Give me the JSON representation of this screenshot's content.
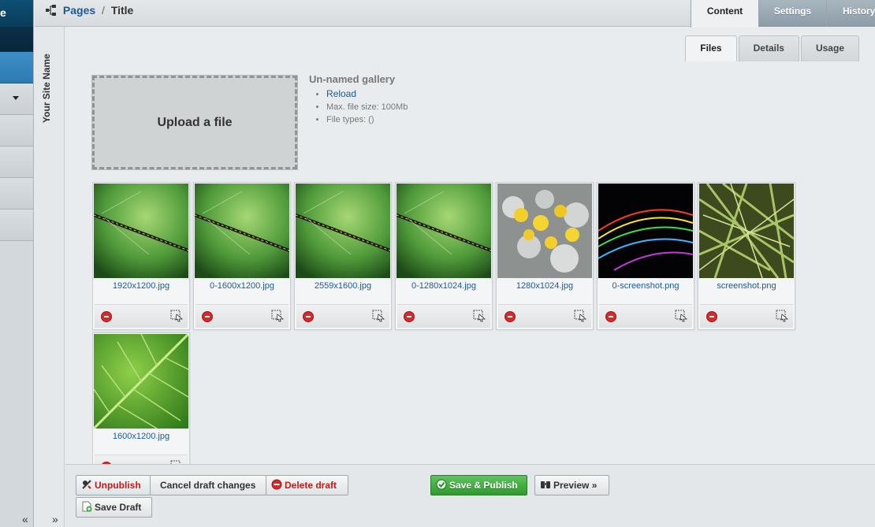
{
  "header": {
    "breadcrumb_parent": "Pages",
    "breadcrumb_separator": "/",
    "breadcrumb_current": "Title",
    "tabs": [
      {
        "label": "Content",
        "active": true
      },
      {
        "label": "Settings",
        "active": false
      },
      {
        "label": "History",
        "active": false
      }
    ]
  },
  "leftnav": {
    "brand_fragment": "e",
    "expand_label": "«"
  },
  "sitecol": {
    "site_name": "Your Site Name",
    "collapse_label": "»"
  },
  "subtabs": [
    {
      "label": "Files",
      "active": true
    },
    {
      "label": "Details",
      "active": false
    },
    {
      "label": "Usage",
      "active": false
    }
  ],
  "upload": {
    "label": "Upload a file"
  },
  "gallery": {
    "title": "Un-named gallery",
    "reload": "Reload",
    "max_size": "Max. file size: 100Mb",
    "file_types": "File types: ()"
  },
  "files": [
    {
      "name": "1920x1200.jpg",
      "thumb": "dragonfly"
    },
    {
      "name": "0-1600x1200.jpg",
      "thumb": "dragonfly"
    },
    {
      "name": "2559x1600.jpg",
      "thumb": "dragonfly"
    },
    {
      "name": "0-1280x1024.jpg",
      "thumb": "dragonfly"
    },
    {
      "name": "1280x1024.jpg",
      "thumb": "flowers"
    },
    {
      "name": "0-screenshot.png",
      "thumb": "lights"
    },
    {
      "name": "screenshot.png",
      "thumb": "grass"
    },
    {
      "name": "1600x1200.jpg",
      "thumb": "leaf"
    }
  ],
  "actions": {
    "unpublish": "Unpublish",
    "cancel_draft": "Cancel draft changes",
    "delete_draft": "Delete draft",
    "save_publish": "Save & Publish",
    "preview": "Preview »",
    "save_draft": "Save Draft"
  },
  "colors": {
    "accent": "#1a5a9c",
    "nav_dark": "#0a2f48",
    "nav_active": "#3c8fc6",
    "danger": "#c81818",
    "publish": "#3da83d"
  }
}
